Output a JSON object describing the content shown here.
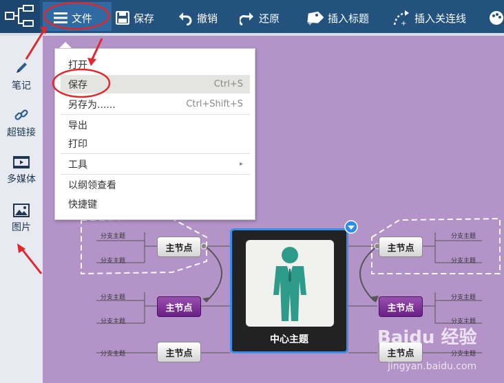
{
  "toolbar": {
    "file": "文件",
    "save": "保存",
    "undo": "撤销",
    "redo": "还原",
    "insert_label": "插入标题",
    "insert_relation": "插入关连线"
  },
  "sidebar": {
    "items": [
      {
        "label": "笔记",
        "icon": "pen-icon"
      },
      {
        "label": "超链接",
        "icon": "link-icon"
      },
      {
        "label": "多媒体",
        "icon": "video-icon"
      },
      {
        "label": "图片",
        "icon": "image-icon"
      }
    ]
  },
  "menu": {
    "items": [
      {
        "label": "打开",
        "shortcut": ""
      },
      {
        "label": "保存",
        "shortcut": "Ctrl+S"
      },
      {
        "label": "另存为......",
        "shortcut": "Ctrl+Shift+S"
      },
      {
        "label": "导出",
        "shortcut": ""
      },
      {
        "label": "打印",
        "shortcut": ""
      },
      {
        "label": "工具",
        "shortcut": ""
      },
      {
        "label": "以纲领查看",
        "shortcut": ""
      },
      {
        "label": "快捷键",
        "shortcut": ""
      }
    ]
  },
  "mindmap": {
    "center": "中心主题",
    "main_node": "主节点",
    "sub_node": "分支主题"
  },
  "watermark": {
    "brand": "Baidu 经验",
    "url": "jingyan.baidu.com"
  },
  "colors": {
    "toolbar": "#23527f",
    "canvas": "#b393c8",
    "annotation": "#e0282c"
  }
}
